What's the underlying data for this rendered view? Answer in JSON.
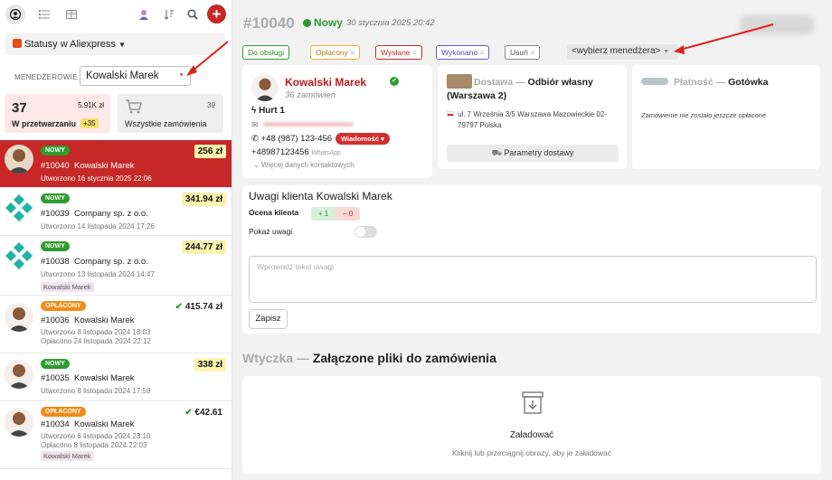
{
  "sidebar": {
    "status_dropdown": "Statusy w Aliexpress",
    "manager_label": "MENEDŻEROWIE",
    "manager_value": "Kowalski Marek",
    "card_processing": {
      "count": "37",
      "amount": "5.91K zł",
      "label": "W przetwarzaniu",
      "delta": "+35"
    },
    "card_all": {
      "count": "39",
      "label": "Wszystkie zamówienia"
    },
    "orders": [
      {
        "badge": "NOWY",
        "number": "#10040",
        "customer": "Kowalski Marek",
        "created": "Utworzono 16 stycznia 2025 22:06",
        "price": "256 zł"
      },
      {
        "badge": "NOWY",
        "number": "#10039",
        "customer": "Company sp. z o.o.",
        "created": "Utworzono 14 listopada 2024 17:26",
        "price": "341.94 zł"
      },
      {
        "badge": "NOWY",
        "number": "#10038",
        "customer": "Company sp. z o.o.",
        "created": "Utworzono 13 listopada 2024 14:47",
        "price": "244.77 zł",
        "manager": "Kowalski Marek"
      },
      {
        "badge": "OPŁACONY",
        "number": "#10036",
        "customer": "Kowalski Marek",
        "created": "Utworzono 8 listopada 2024 18:03",
        "paid": "Opłacono 24 listopada 2024 22:12",
        "price": "415.74 zł"
      },
      {
        "badge": "NOWY",
        "number": "#10035",
        "customer": "Kowalski Marek",
        "created": "Utworzono 8 listopada 2024 17:59",
        "price": "338 zł"
      },
      {
        "badge": "OPŁACONY",
        "number": "#10034",
        "customer": "Kowalski Marek",
        "created": "Utworzono 6 listopada 2024 23:10",
        "paid": "Opłacono 8 listopada 2024 22:03",
        "price": "€42.61",
        "manager": "Kowalski Marek"
      }
    ]
  },
  "header": {
    "order_number": "#10040",
    "status": "Nowy",
    "date": "30 stycznia 2025 20:42"
  },
  "status_buttons": [
    "Do obsługi",
    "Opłacony",
    "Wysłane",
    "Wykonano",
    "Usuń"
  ],
  "manager_picker": "<wybierz menedżera>",
  "customer": {
    "name": "Kowalski Marek",
    "orders": "36 zamówień",
    "tier": "Hurt 1",
    "phone": "+48 (987) 123-456",
    "message_btn": "Wiadomość",
    "whatsapp_phone": "+48987123456",
    "whatsapp_label": "WhatsApp",
    "more_contacts": "Więcej danych kontaktowych"
  },
  "delivery": {
    "title_prefix": "Dostawa —",
    "title_value": "Odbiór własny (Warszawa 2)",
    "address": "ul. 7 Września 3/5 Warszawa Mazowieckie 02-79797 Polska",
    "params_btn": "Parametry dostawy"
  },
  "payment": {
    "title_prefix": "Płatność —",
    "title_value": "Gotówka",
    "status": "Zamówienie nie zostało jeszcze opłacone"
  },
  "notes": {
    "title": "Uwagi klienta Kowalski Marek",
    "rating_label": "Ocena klienta",
    "plus": "+ 1",
    "minus": "− 0",
    "show_notes": "Pokaż uwagi",
    "placeholder": "Wprowadź tekst uwagi",
    "save": "Zapisz"
  },
  "plugin": {
    "prefix": "Wtyczka —",
    "title": "Załączone pliki do zamówienia",
    "upload": "Załadować",
    "hint": "Kliknij lub przeciągnij obrazy, aby je załadować"
  },
  "colors": {
    "accent": "#c62828",
    "new": "#2e9d2e",
    "paid": "#ef8c1a"
  }
}
